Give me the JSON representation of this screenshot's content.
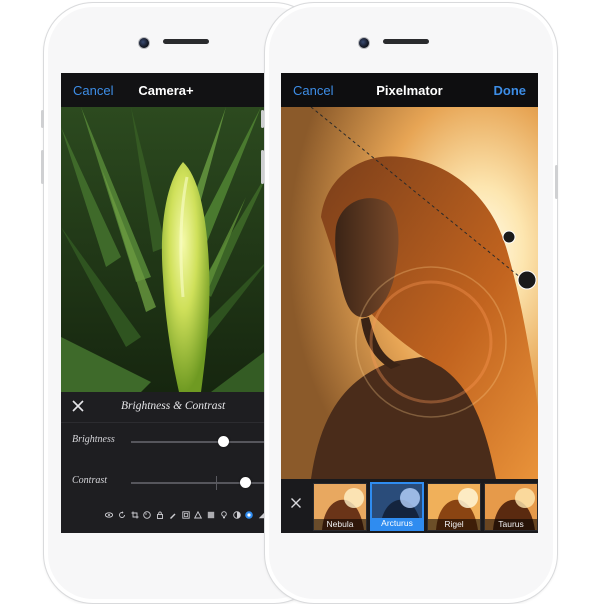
{
  "left_app": {
    "nav": {
      "cancel_label": "Cancel",
      "title": "Camera+",
      "done_label": ""
    },
    "photo_icon": "agave-plant-photo",
    "panel": {
      "close_icon": "close-icon",
      "title": "Brightness & Contrast",
      "sliders": [
        {
          "label": "Brightness",
          "value": 0.66
        },
        {
          "label": "Contrast",
          "value": 0.82
        }
      ]
    },
    "toolbar_icons": [
      "eye-icon",
      "rotate-icon",
      "crop-icon",
      "palette-icon",
      "lock-icon",
      "brush-icon",
      "frame-icon",
      "triangle-icon",
      "grid-icon",
      "bulb-icon",
      "filter-icon",
      "brightness-icon",
      "exposure-icon"
    ]
  },
  "right_app": {
    "nav": {
      "cancel_label": "Cancel",
      "title": "Pixelmator",
      "done_label": "Done"
    },
    "photo_icon": "backlit-portrait-photo",
    "filters": [
      {
        "label": "Nebula"
      },
      {
        "label": "Arcturus",
        "selected": true
      },
      {
        "label": "Rigel"
      },
      {
        "label": "Taurus"
      }
    ],
    "colors": {
      "accent": "#2f8cf0",
      "nav_link": "#3d8de6"
    }
  }
}
